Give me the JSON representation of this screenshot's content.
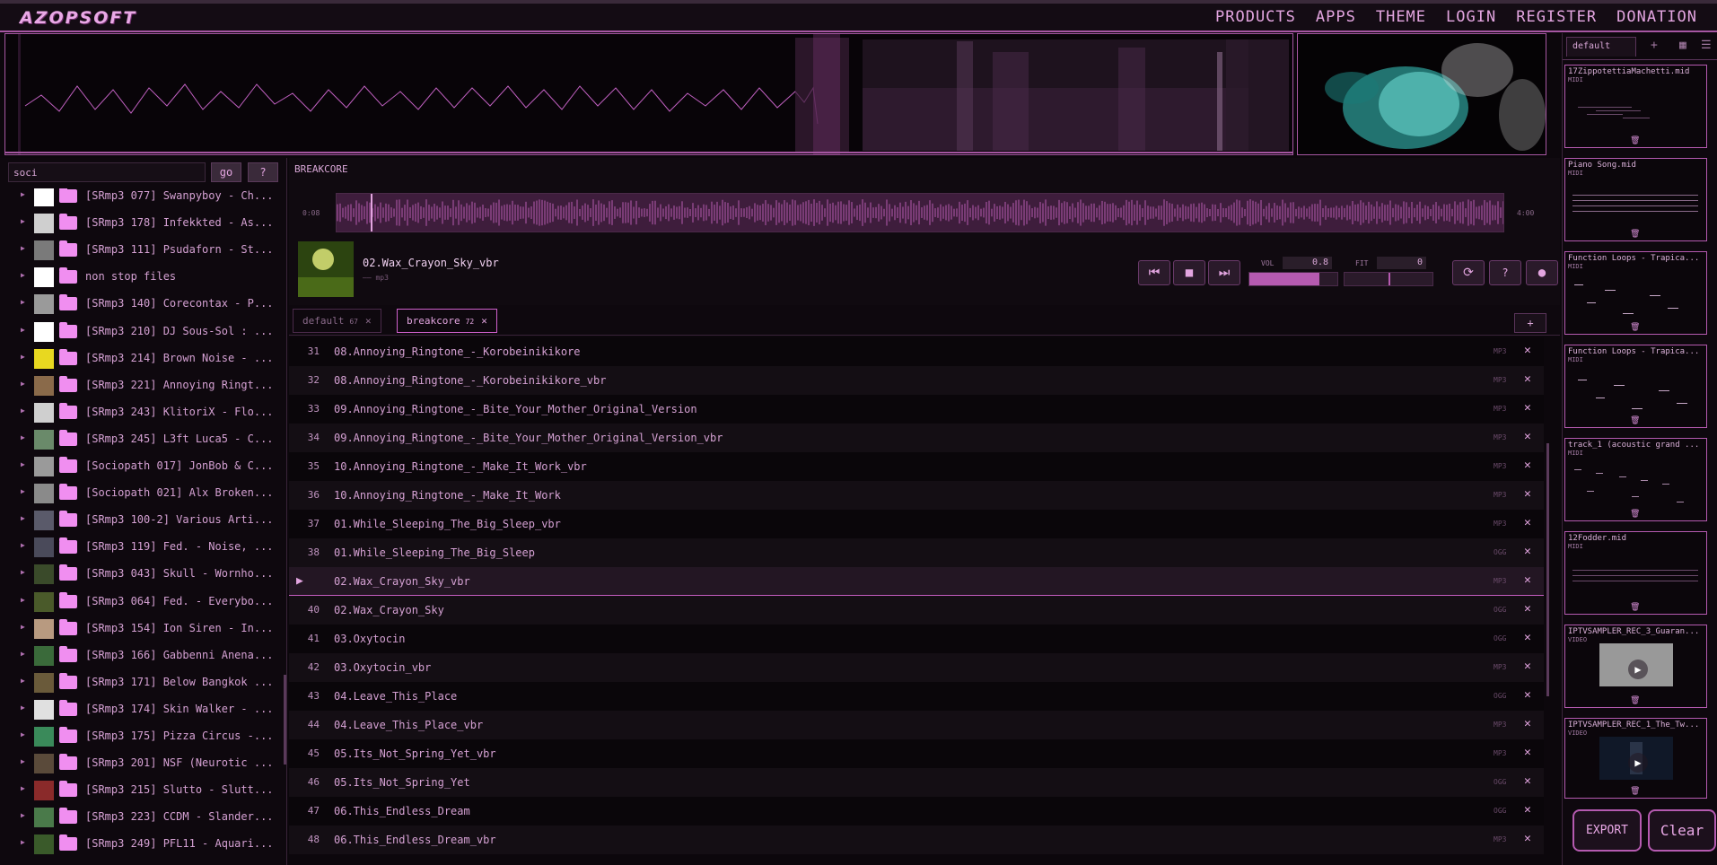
{
  "logo": "AZOPSOFT",
  "nav": [
    "PRODUCTS",
    "APPS",
    "THEME",
    "LOGIN",
    "REGISTER",
    "DONATION"
  ],
  "sidebar_right": {
    "tab": "default",
    "cards": [
      {
        "name": "17ZippotettiaMachetti.mid",
        "type": "MIDI"
      },
      {
        "name": "Piano Song.mid",
        "type": "MIDI"
      },
      {
        "name": "Function Loops - Trapica...",
        "type": "MIDI"
      },
      {
        "name": "Function Loops - Trapica...",
        "type": "MIDI"
      },
      {
        "name": "track_1 (acoustic grand ...",
        "type": "MIDI"
      },
      {
        "name": "12Fodder.mid",
        "type": "MIDI"
      },
      {
        "name": "IPTVSAMPLER_REC_3_Guaran...",
        "type": "VIDEO"
      },
      {
        "name": "IPTVSAMPLER_REC_1_The_Tw...",
        "type": "VIDEO"
      }
    ],
    "export": "EXPORT",
    "clear": "Clear"
  },
  "search": {
    "value": "soci",
    "go": "go",
    "help": "?"
  },
  "tree": [
    "[SRmp3 077] Swanpyboy - Ch...",
    "[SRmp3 178] Infekkted - As...",
    "[SRmp3 111] Psudaforn - St...",
    "non stop files",
    "[SRmp3 140] Corecontax - P...",
    "[SRmp3 210] DJ Sous-Sol : ...",
    "[SRmp3 214] Brown Noise - ...",
    "[SRmp3 221] Annoying Ringt...",
    "[SRmp3 243] KlitoriX - Flo...",
    "[SRmp3 245] L3ft Luca5 - C...",
    "[Sociopath 017] JonBob & C...",
    "[Sociopath 021] Alx Broken...",
    "[SRmp3 100-2] Various Arti...",
    "[SRmp3 119] Fed. - Noise, ...",
    "[SRmp3 043] Skull - Wornho...",
    "[SRmp3 064] Fed. - Everybo...",
    "[SRmp3 154] Ion Siren - In...",
    "[SRmp3 166] Gabbenni Anena...",
    "[SRmp3 171] Below Bangkok ...",
    "[SRmp3 174] Skin Walker - ...",
    "[SRmp3 175] Pizza Circus -...",
    "[SRmp3 201] NSF (Neurotic ...",
    "[SRmp3 215] Slutto - Slutt...",
    "[SRmp3 223] CCDM - Slander...",
    "[SRmp3 249] PFL11 - Aquari..."
  ],
  "player": {
    "title": "BREAKCORE",
    "time_start": "0:08",
    "time_end": "4:00",
    "track": "02.Wax_Crayon_Sky_vbr",
    "format": "—— mp3",
    "vol_label": "VOL",
    "vol_value": "0.8",
    "fit_label": "FIT",
    "fit_value": "0",
    "vol_level": 0.8,
    "fit_level": 0.5
  },
  "tabs": [
    {
      "label": "default",
      "count": "67"
    },
    {
      "label": "breakcore",
      "count": "72"
    }
  ],
  "add_tab": "+",
  "rows": [
    {
      "n": "31",
      "name": "08.Annoying_Ringtone_-_Korobeinikikore",
      "fmt": "MP3"
    },
    {
      "n": "32",
      "name": "08.Annoying_Ringtone_-_Korobeinikikore_vbr",
      "fmt": "MP3"
    },
    {
      "n": "33",
      "name": "09.Annoying_Ringtone_-_Bite_Your_Mother_Original_Version",
      "fmt": "MP3"
    },
    {
      "n": "34",
      "name": "09.Annoying_Ringtone_-_Bite_Your_Mother_Original_Version_vbr",
      "fmt": "MP3"
    },
    {
      "n": "35",
      "name": "10.Annoying_Ringtone_-_Make_It_Work_vbr",
      "fmt": "MP3"
    },
    {
      "n": "36",
      "name": "10.Annoying_Ringtone_-_Make_It_Work",
      "fmt": "MP3"
    },
    {
      "n": "37",
      "name": "01.While_Sleeping_The_Big_Sleep_vbr",
      "fmt": "MP3"
    },
    {
      "n": "38",
      "name": "01.While_Sleeping_The_Big_Sleep",
      "fmt": "OGG"
    },
    {
      "n": "",
      "name": "02.Wax_Crayon_Sky_vbr",
      "fmt": "MP3",
      "playing": true
    },
    {
      "n": "40",
      "name": "02.Wax_Crayon_Sky",
      "fmt": "OGG"
    },
    {
      "n": "41",
      "name": "03.Oxytocin",
      "fmt": "OGG"
    },
    {
      "n": "42",
      "name": "03.Oxytocin_vbr",
      "fmt": "MP3"
    },
    {
      "n": "43",
      "name": "04.Leave_This_Place",
      "fmt": "OGG"
    },
    {
      "n": "44",
      "name": "04.Leave_This_Place_vbr",
      "fmt": "MP3"
    },
    {
      "n": "45",
      "name": "05.Its_Not_Spring_Yet_vbr",
      "fmt": "MP3"
    },
    {
      "n": "46",
      "name": "05.Its_Not_Spring_Yet",
      "fmt": "OGG"
    },
    {
      "n": "47",
      "name": "06.This_Endless_Dream",
      "fmt": "OGG"
    },
    {
      "n": "48",
      "name": "06.This_Endless_Dream_vbr",
      "fmt": "MP3"
    }
  ],
  "colors": {
    "accent": "#b55ab0",
    "text": "#d8a6d6",
    "folder": "#f08ef0",
    "bg": "#0c070c"
  }
}
